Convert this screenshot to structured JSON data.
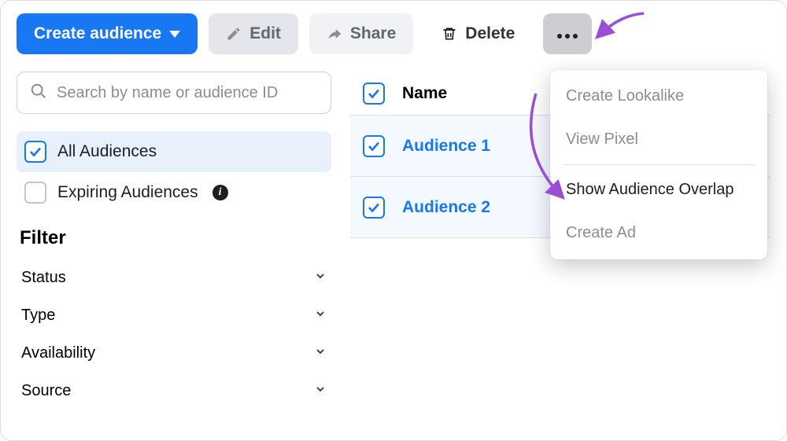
{
  "toolbar": {
    "create": "Create audience",
    "edit": "Edit",
    "share": "Share",
    "delete": "Delete"
  },
  "search": {
    "placeholder": "Search by name or audience ID"
  },
  "sidebar": {
    "all": "All Audiences",
    "expiring": "Expiring Audiences",
    "filterHeading": "Filter",
    "filters": {
      "status": "Status",
      "type": "Type",
      "availability": "Availability",
      "source": "Source"
    }
  },
  "table": {
    "nameHeader": "Name",
    "rows": [
      "Audience 1",
      "Audience 2"
    ]
  },
  "dropdown": {
    "lookalike": "Create Lookalike",
    "pixel": "View Pixel",
    "overlap": "Show Audience Overlap",
    "createAd": "Create Ad"
  }
}
